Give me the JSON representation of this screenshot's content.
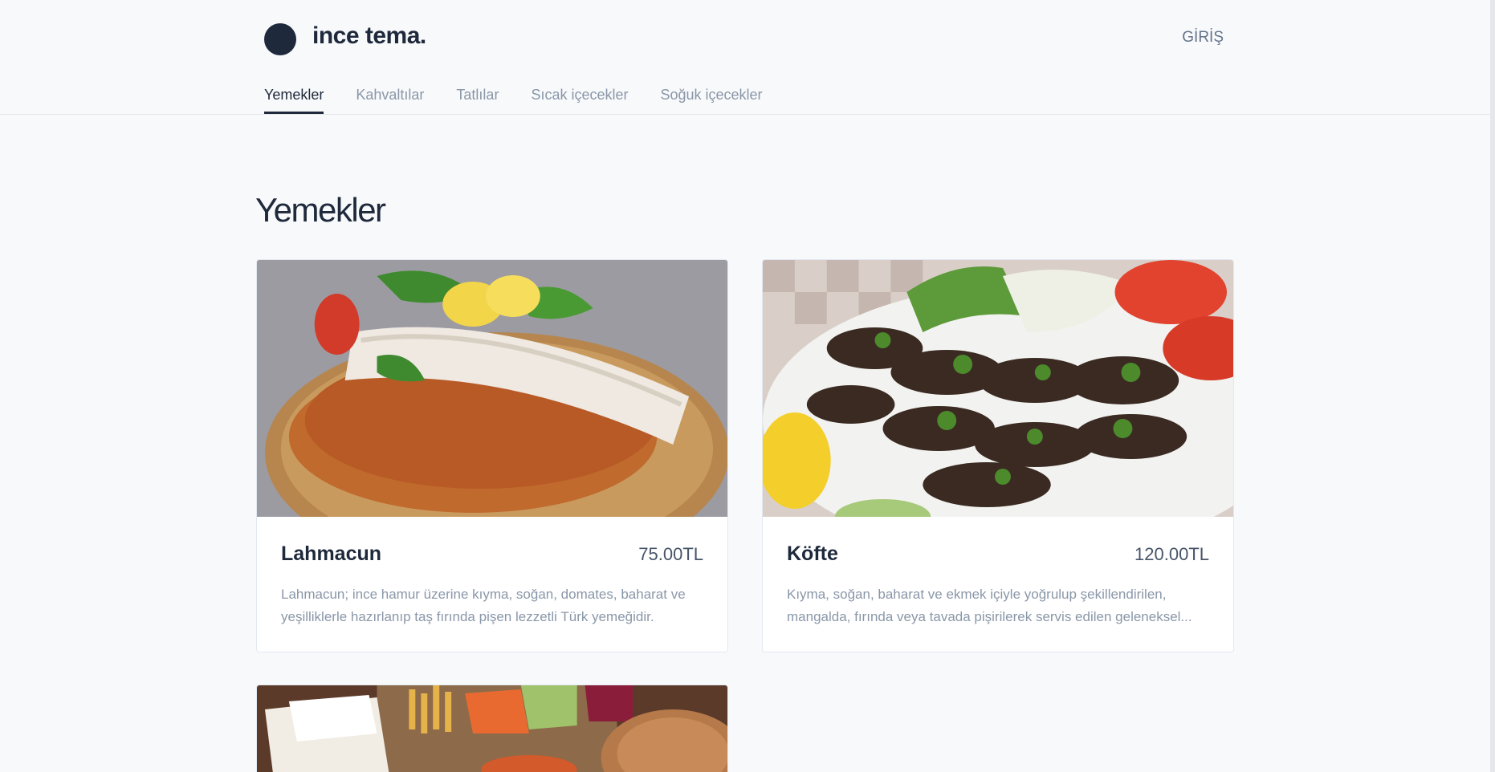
{
  "header": {
    "brand": "ince tema.",
    "login_label": "GİRİŞ"
  },
  "nav": {
    "tabs": [
      {
        "label": "Yemekler",
        "active": true
      },
      {
        "label": "Kahvaltılar",
        "active": false
      },
      {
        "label": "Tatlılar",
        "active": false
      },
      {
        "label": "Sıcak içecekler",
        "active": false
      },
      {
        "label": "Soğuk içecekler",
        "active": false
      }
    ]
  },
  "section": {
    "title": "Yemekler"
  },
  "products": [
    {
      "name": "Lahmacun",
      "price": "75.00TL",
      "description": "Lahmacun; ince hamur üzerine kıyma, soğan, domates, baharat ve yeşilliklerle hazırlanıp taş fırında pişen lezzetli Türk yemeğidir."
    },
    {
      "name": "Köfte",
      "price": "120.00TL",
      "description": "Kıyma, soğan, baharat ve ekmek içiyle yoğrulup şekillendirilen, mangalda, fırında veya tavada pişirilerek servis edilen geleneksel..."
    }
  ],
  "colors": {
    "background": "#f8f9fb",
    "primary_text": "#1e293b",
    "muted_text": "#8a97a8"
  }
}
